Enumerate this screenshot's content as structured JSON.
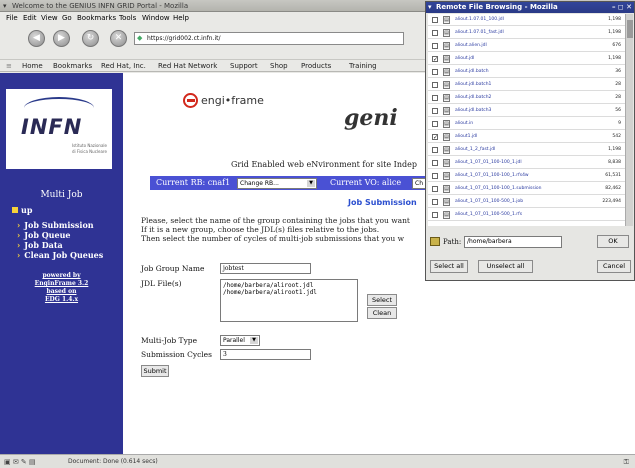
{
  "window": {
    "title": "Welcome to the GENIUS INFN GRID Portal - Mozilla"
  },
  "menu": [
    "File",
    "Edit",
    "View",
    "Go",
    "Bookmarks",
    "Tools",
    "Window",
    "Help"
  ],
  "nav": {
    "url": "https://grid002.ct.infn.it/"
  },
  "bookmarks": [
    "Home",
    "Bookmarks",
    "Red Hat, Inc.",
    "Red Hat Network",
    "Support",
    "Shop",
    "Products",
    "Training"
  ],
  "sidebar": {
    "logo_text": "INFN",
    "logo_sub1": "Istituto Nazionale",
    "logo_sub2": "di Fisica Nucleare",
    "heading": "Multi Job",
    "up_label": "up",
    "items": [
      "Job Submission",
      "Job Queue",
      "Job Data",
      "Clean Job Queues"
    ],
    "powered": [
      "powered by",
      "EnginFrame 3.2",
      "based on",
      "EDG 1.4.x"
    ]
  },
  "page": {
    "engi_logo": "engi•frame",
    "geni_logo": "geni",
    "tagline": "Grid Enabled web eNvironment for site Indep",
    "current_rb_label": "Current RB: cnaf1",
    "change_rb": "Change RB...",
    "current_vo_label": "Current VO: alice",
    "vo_select_visible": "Ch",
    "job_submission_link": "Job Submission",
    "para1": "Please, select the name of the group containing the jobs that you want",
    "para2": "If it is a new group, choose the JDL(s) files relative to the jobs.",
    "para3": "Then select the number of cycles of multi-job submissions that you w",
    "job_group_label": "Job Group Name",
    "job_group_value": "jobtest",
    "jdl_label": "JDL File(s)",
    "jdl_files": [
      "/home/barbera/aliroot.jdl",
      "/home/barbera/aliroot1.jdl"
    ],
    "select_button": "Select",
    "clean_button": "Clean",
    "multijob_label": "Multi-Job Type",
    "multijob_value": "Parallel",
    "cycles_label": "Submission Cycles",
    "cycles_value": "3",
    "submit_button": "Submit"
  },
  "status": {
    "text": "Document: Done (0.614 secs)"
  },
  "popup": {
    "title": "Remote File Browsing - Mozilla",
    "rows": [
      {
        "name": "aliout.1.07.01_100.jdl",
        "size": "1,198",
        "checked": false
      },
      {
        "name": "aliout.1.07.01_fast.jdl",
        "size": "1,198",
        "checked": false
      },
      {
        "name": "aliout.alien.jdl",
        "size": "676",
        "checked": false
      },
      {
        "name": "aliout.jdl",
        "size": "1,198",
        "checked": true
      },
      {
        "name": "aliout.jdl.batch",
        "size": "36",
        "checked": false
      },
      {
        "name": "aliout.jdl.batch1",
        "size": "28",
        "checked": false
      },
      {
        "name": "aliout.jdl.batch2",
        "size": "28",
        "checked": false
      },
      {
        "name": "aliout.jdl.batch3",
        "size": "56",
        "checked": false
      },
      {
        "name": "aliout.in",
        "size": "9",
        "checked": false
      },
      {
        "name": "aliout1.jdl",
        "size": "542",
        "checked": true
      },
      {
        "name": "aliout_1_2_fast.jdl",
        "size": "1,198",
        "checked": false
      },
      {
        "name": "aliout_1_07_01_100-100_1.jdl",
        "size": "8,838",
        "checked": false
      },
      {
        "name": "aliout_1_07_01_100-100_1.rfs4w",
        "size": "61,531",
        "checked": false
      },
      {
        "name": "aliout_1_07_01_100-100_1.submission",
        "size": "82,462",
        "checked": false
      },
      {
        "name": "aliout_1_07_01_100-500_1.job",
        "size": "223,494",
        "checked": false
      },
      {
        "name": "aliout_1_07_01_100-500_1.rfs",
        "size": "",
        "checked": false
      }
    ],
    "path_label": "Path:",
    "path_value": "/home/barbera",
    "ok_button": "OK",
    "select_all_button": "Select all",
    "unselect_all_button": "Unselect all",
    "cancel_button": "Cancel"
  }
}
